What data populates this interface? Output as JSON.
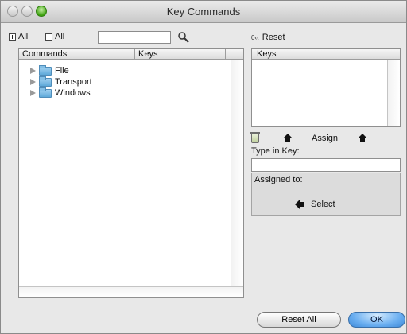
{
  "window": {
    "title": "Key Commands"
  },
  "toolbar": {
    "expand_all_label": "All",
    "collapse_all_label": "All",
    "search_value": "",
    "search_icon": "magnifier-icon"
  },
  "commands_table": {
    "headers": [
      "Commands",
      "Keys"
    ],
    "items": [
      {
        "label": "File",
        "icon": "folder-icon"
      },
      {
        "label": "Transport",
        "icon": "folder-icon"
      },
      {
        "label": "Windows",
        "icon": "folder-icon"
      }
    ]
  },
  "right_panel": {
    "reset_label": "Reset",
    "keys_header": "Keys",
    "assign_label": "Assign",
    "type_in_key_label": "Type in Key:",
    "type_in_key_value": "",
    "assigned_to_label": "Assigned to:",
    "select_label": "Select"
  },
  "buttons": {
    "reset_all_label": "Reset All",
    "ok_label": "OK"
  },
  "colors": {
    "ok_button": "#6aaef0",
    "window_bg": "#e8e8e8",
    "zoom_light": "#3ea20f"
  }
}
